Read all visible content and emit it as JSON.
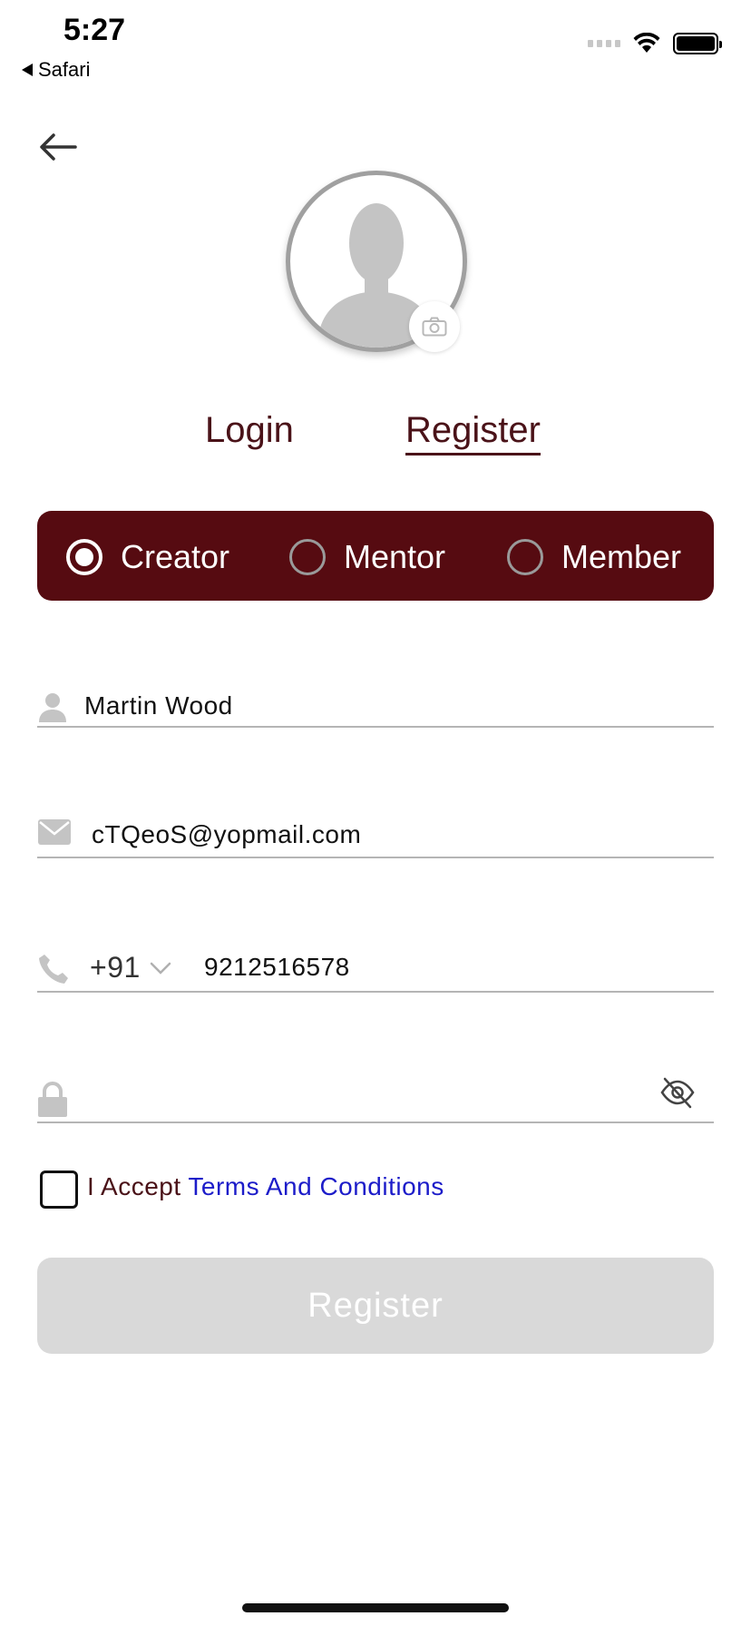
{
  "status_bar": {
    "time": "5:27",
    "back_app": "Safari"
  },
  "profile": {
    "avatar_icon": "person-silhouette-icon",
    "camera_icon": "camera-icon"
  },
  "tabs": [
    {
      "label": "Login",
      "active": false
    },
    {
      "label": "Register",
      "active": true
    }
  ],
  "roles": [
    {
      "label": "Creator",
      "selected": true
    },
    {
      "label": "Mentor",
      "selected": false
    },
    {
      "label": "Member",
      "selected": false
    }
  ],
  "form": {
    "name": "Martin Wood",
    "email": "cTQeoS@yopmail.com",
    "country_code": "+91",
    "phone": "9212516578",
    "password": ""
  },
  "terms": {
    "prefix": "I Accept ",
    "link": "Terms And Conditions",
    "checked": false
  },
  "register_button": {
    "label": "Register",
    "enabled": false
  },
  "colors": {
    "brand": "#560b11",
    "tab_text": "#4a1218",
    "link": "#1c1cc9",
    "disabled": "#d9d9d9"
  }
}
